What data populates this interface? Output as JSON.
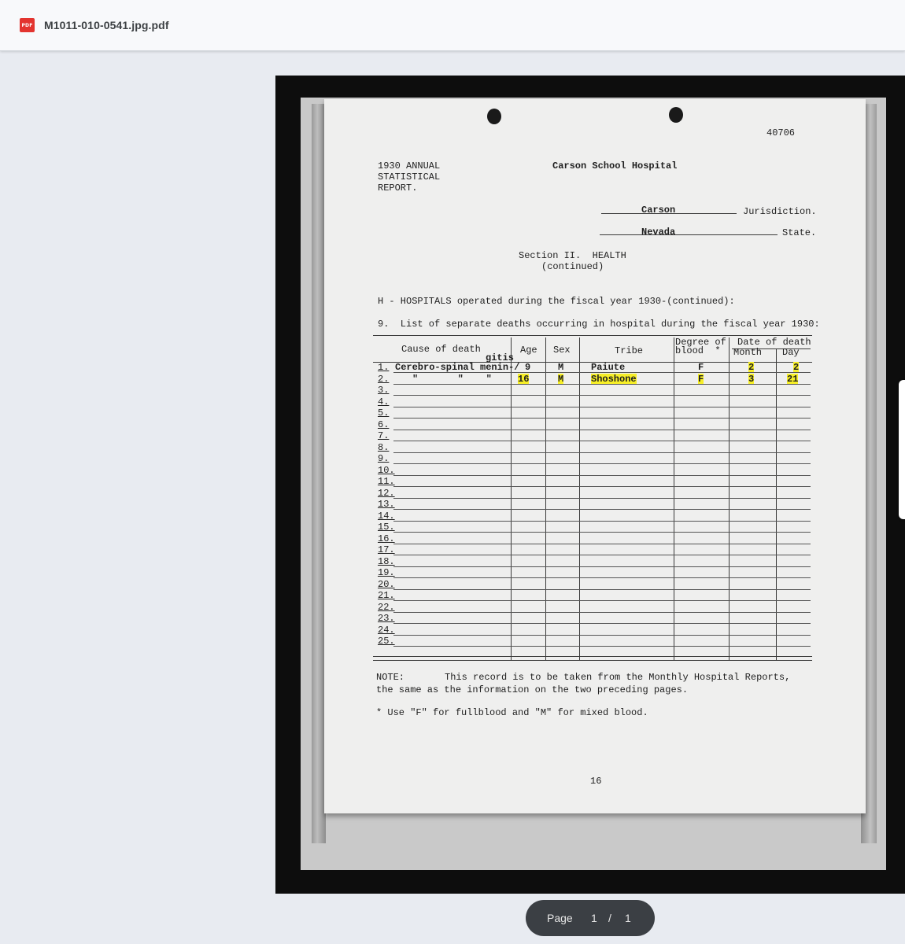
{
  "toolbar": {
    "file_icon": "pdf-file-icon",
    "file_icon_label": "PDF",
    "file_name": "M1011-010-0541.jpg.pdf"
  },
  "pager": {
    "label": "Page",
    "current": "1",
    "separator": "/",
    "total": "1"
  },
  "document": {
    "doc_number": "40706",
    "report_line1": "1930 ANNUAL",
    "report_line2": "STATISTICAL",
    "report_line3": "REPORT.",
    "hospital": "Carson School Hospital",
    "jurisdiction_value": "Carson",
    "jurisdiction_label": "Jurisdiction.",
    "state_value": "Nevada",
    "state_label": "State.",
    "section_line1": "Section II.  HEALTH",
    "section_line2": "(continued)",
    "hospitals_line": "H - HOSPITALS operated during the fiscal year 1930-(continued):",
    "list_line": "9.  List of separate deaths occurring in hospital during the fiscal year 1930:",
    "headers": {
      "cause": "Cause of death",
      "age": "Age",
      "sex": "Sex",
      "tribe": "Tribe",
      "degree_line1": "Degree of",
      "degree_line2": "blood  *",
      "date": "Date of death",
      "month": "Month",
      "day": "Day"
    },
    "rows": [
      {
        "num": "1.",
        "cause": "Cerebro-spinal menin-/",
        "cause_insert": "gitis",
        "age": "9",
        "sex": "M",
        "tribe": "Paiute",
        "degree": "F",
        "month": "2",
        "day": "2"
      },
      {
        "num": "2.",
        "cause": "\"       \"    \"",
        "cause_insert": "",
        "age": "16",
        "sex": "M",
        "tribe": "Shoshone",
        "degree": "F",
        "month": "3",
        "day": "21"
      }
    ],
    "empty_row_numbers": [
      "3.",
      "4.",
      "5.",
      "6.",
      "7.",
      "8.",
      "9.",
      "10.",
      "11.",
      "12.",
      "13.",
      "14.",
      "15.",
      "16.",
      "17.",
      "18.",
      "19.",
      "20.",
      "21.",
      "22.",
      "23.",
      "24.",
      "25."
    ],
    "note_label": "NOTE:",
    "note_line1": "This record is to be taken from the Monthly Hospital Reports,",
    "note_line2": "the same as the information on the two preceding pages.",
    "footnote": "* Use \"F\" for fullblood and \"M\" for mixed blood.",
    "page_number": "16"
  }
}
